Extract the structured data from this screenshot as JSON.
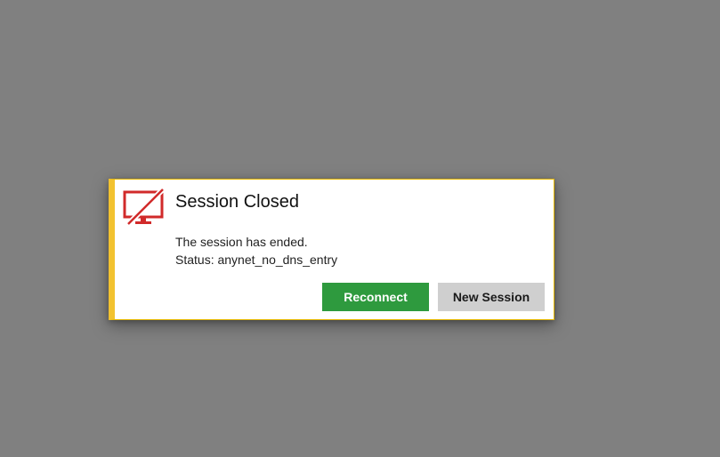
{
  "dialog": {
    "icon": "monitor-disconnected-icon",
    "title": "Session Closed",
    "message_line1": "The session has ended.",
    "message_line2": "Status: anynet_no_dns_entry",
    "reconnect_label": "Reconnect",
    "new_session_label": "New Session"
  },
  "colors": {
    "backdrop": "#808080",
    "accent_stripe": "#f2c230",
    "icon_red": "#d12a2a",
    "reconnect_bg": "#2e9a3e",
    "new_session_bg": "#cfcfcf"
  }
}
